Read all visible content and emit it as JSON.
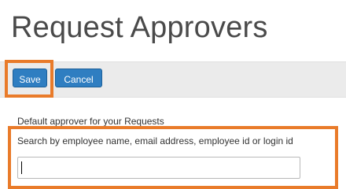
{
  "page": {
    "title": "Request Approvers"
  },
  "toolbar": {
    "save_label": "Save",
    "cancel_label": "Cancel"
  },
  "form": {
    "section_label": "Default approver for your Requests",
    "search_label": "Search by employee name, email address, employee id or login id",
    "search_value": ""
  },
  "colors": {
    "primary_button": "#2f7ec1",
    "highlight": "#e97b2a",
    "toolbar_background": "#ebebeb"
  }
}
